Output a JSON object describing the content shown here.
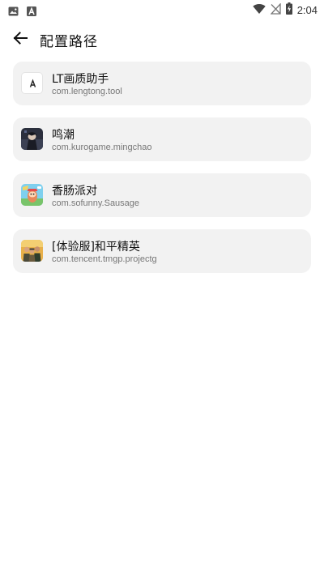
{
  "status_bar": {
    "time": "2:04",
    "left_icons": [
      "gallery-icon",
      "a-letter-icon"
    ],
    "right_icons": [
      "wifi-icon",
      "no-signal-icon",
      "battery-charging-icon"
    ]
  },
  "header": {
    "back_icon": "arrow-left-icon",
    "title": "配置路径"
  },
  "apps": [
    {
      "name": "LT画质助手",
      "package": "com.lengtong.tool",
      "icon": "lt-app-icon"
    },
    {
      "name": "鸣潮",
      "package": "com.kurogame.mingchao",
      "icon": "mingchao-app-icon"
    },
    {
      "name": "香肠派对",
      "package": "com.sofunny.Sausage",
      "icon": "sausage-app-icon"
    },
    {
      "name": "[体验服]和平精英",
      "package": "com.tencent.tmgp.projectg",
      "icon": "pubg-app-icon"
    }
  ],
  "colors": {
    "card_background": "#f2f2f2",
    "title_text": "#111111",
    "secondary_text": "#777777"
  }
}
